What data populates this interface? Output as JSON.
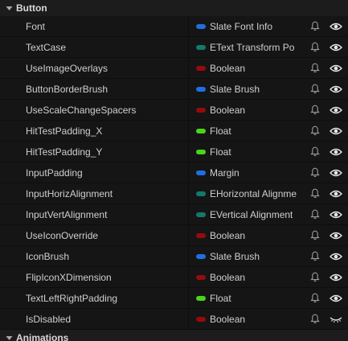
{
  "sections": {
    "button": {
      "label": "Button"
    },
    "animations": {
      "label": "Animations"
    }
  },
  "type_colors": {
    "struct_blue": "#1f6fe0",
    "enum_teal": "#127a6a",
    "bool_red": "#950b0b",
    "float_green": "#49d51a"
  },
  "icons": {
    "notify": "bell-icon",
    "visible": "eye-icon",
    "hidden": "eye-closed-icon"
  },
  "rows": [
    {
      "name": "Font",
      "type": "Slate Font Info",
      "color": "#1f6fe0",
      "visible": true
    },
    {
      "name": "TextCase",
      "type": "EText Transform Po",
      "color": "#127a6a",
      "visible": true
    },
    {
      "name": "UseImageOverlays",
      "type": "Boolean",
      "color": "#950b0b",
      "visible": true
    },
    {
      "name": "ButtonBorderBrush",
      "type": "Slate Brush",
      "color": "#1f6fe0",
      "visible": true
    },
    {
      "name": "UseScaleChangeSpacers",
      "type": "Boolean",
      "color": "#950b0b",
      "visible": true
    },
    {
      "name": "HitTestPadding_X",
      "type": "Float",
      "color": "#49d51a",
      "visible": true
    },
    {
      "name": "HitTestPadding_Y",
      "type": "Float",
      "color": "#49d51a",
      "visible": true
    },
    {
      "name": "InputPadding",
      "type": "Margin",
      "color": "#1f6fe0",
      "visible": true
    },
    {
      "name": "InputHorizAlignment",
      "type": "EHorizontal Alignme",
      "color": "#127a6a",
      "visible": true
    },
    {
      "name": "InputVertAlignment",
      "type": "EVertical Alignment",
      "color": "#127a6a",
      "visible": true
    },
    {
      "name": "UseIconOverride",
      "type": "Boolean",
      "color": "#950b0b",
      "visible": true
    },
    {
      "name": "IconBrush",
      "type": "Slate Brush",
      "color": "#1f6fe0",
      "visible": true
    },
    {
      "name": "FlipIconXDimension",
      "type": "Boolean",
      "color": "#950b0b",
      "visible": true
    },
    {
      "name": "TextLeftRightPadding",
      "type": "Float",
      "color": "#49d51a",
      "visible": true
    },
    {
      "name": "IsDisabled",
      "type": "Boolean",
      "color": "#950b0b",
      "visible": false
    }
  ]
}
